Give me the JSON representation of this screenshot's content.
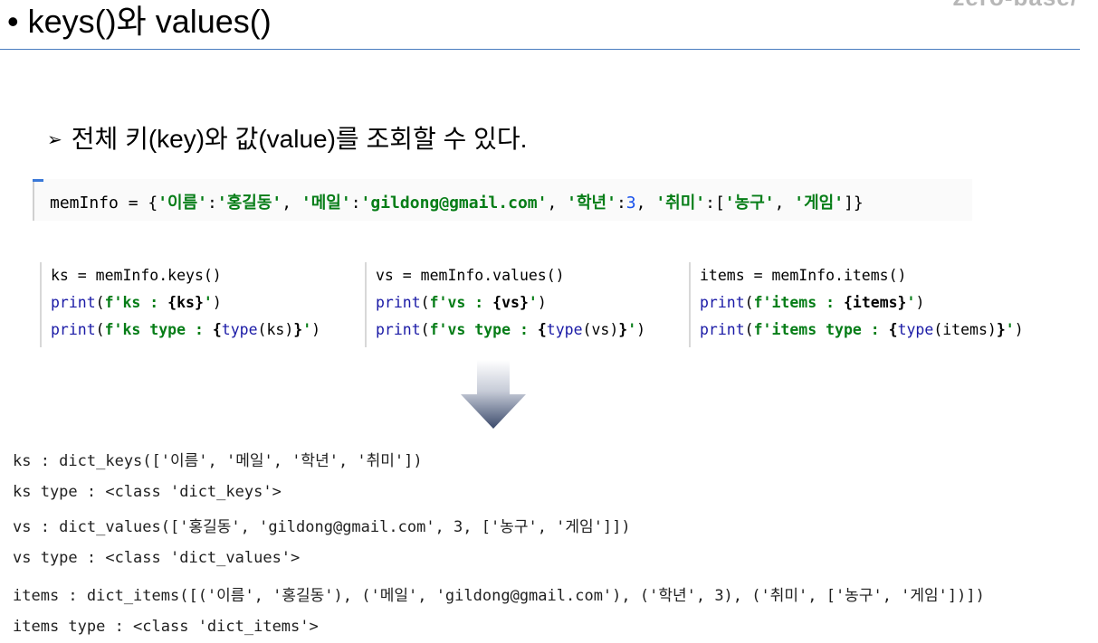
{
  "header": {
    "title": "• keys()와 values()",
    "brand": "zero-base/"
  },
  "bullet": {
    "marker": "➢",
    "text": "전체 키(key)와 값(value)를 조회할 수 있다."
  },
  "code_main": {
    "p1": "memInfo = {",
    "s1": "'이름'",
    "c1": ":",
    "s2": "'홍길동'",
    "c2": ", ",
    "s3": "'메일'",
    "c3": ":",
    "s4": "'gildong@gmail.com'",
    "c4": ", ",
    "s5": "'학년'",
    "c5": ":",
    "n1": "3",
    "c6": ", ",
    "s6": "'취미'",
    "c7": ":[",
    "s7": "'농구'",
    "c8": ", ",
    "s8": "'게임'",
    "c9": "]}"
  },
  "code_blocks": [
    {
      "l1": "ks = memInfo.keys()",
      "l2a": "print",
      "l2b": "(",
      "l2c": "f'ks : ",
      "l2d": "{ks}",
      "l2e": "'",
      "l2f": ")",
      "l3a": "print",
      "l3b": "(",
      "l3c": "f'ks type : ",
      "l3d": "{",
      "l3e": "type",
      "l3f": "(ks)",
      "l3g": "}",
      "l3h": "'",
      "l3i": ")"
    },
    {
      "l1": "vs = memInfo.values()",
      "l2a": "print",
      "l2b": "(",
      "l2c": "f'vs : ",
      "l2d": "{vs}",
      "l2e": "'",
      "l2f": ")",
      "l3a": "print",
      "l3b": "(",
      "l3c": "f'vs type : ",
      "l3d": "{",
      "l3e": "type",
      "l3f": "(vs)",
      "l3g": "}",
      "l3h": "'",
      "l3i": ")"
    },
    {
      "l1": "items = memInfo.items()",
      "l2a": "print",
      "l2b": "(",
      "l2c": "f'items : ",
      "l2d": "{items}",
      "l2e": "'",
      "l2f": ")",
      "l3a": "print",
      "l3b": "(",
      "l3c": "f'items type : ",
      "l3d": "{",
      "l3e": "type",
      "l3f": "(items)",
      "l3g": "}",
      "l3h": "'",
      "l3i": ")"
    }
  ],
  "output": [
    "ks : dict_keys(['이름', '메일', '학년', '취미'])",
    "ks type : <class 'dict_keys'>",
    "vs : dict_values(['홍길동', 'gildong@gmail.com', 3, ['농구', '게임']])",
    "vs type : <class 'dict_values'>",
    "items : dict_items([('이름', '홍길동'), ('메일', 'gildong@gmail.com'), ('학년', 3), ('취미', ['농구', '게임'])])",
    "items type : <class 'dict_items'>"
  ],
  "colors": {
    "string": "#067d17",
    "builtin": "#1a1aa6",
    "number": "#1750eb",
    "rule": "#4a7cc0",
    "arrow_top": "#ffffff",
    "arrow_bottom": "#3b4a6b"
  },
  "icons": {
    "result_arrow": "down-arrow-icon"
  }
}
